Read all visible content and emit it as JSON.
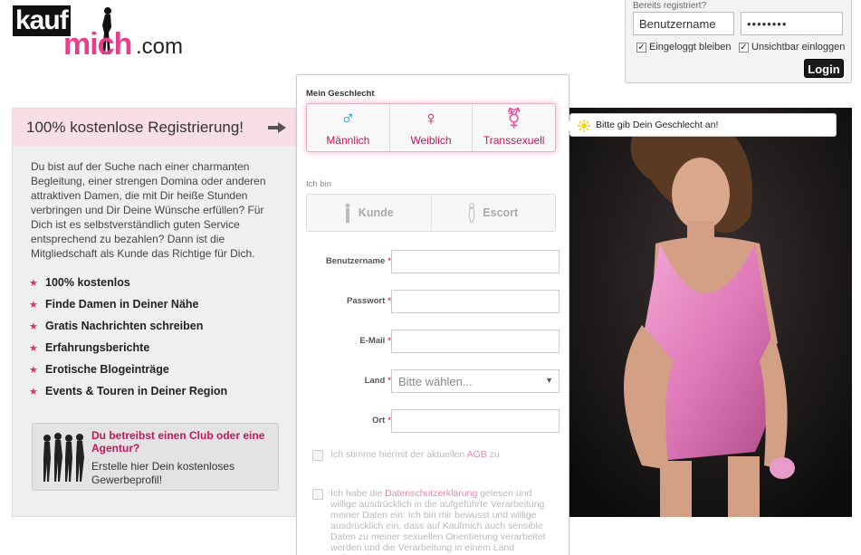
{
  "logo": {
    "part1": "kauf",
    "part2": "mich",
    "part3": ".com"
  },
  "login": {
    "hint": "Bereits registriert?",
    "username_value": "Benutzername",
    "password_value": "••••••••",
    "stay_logged_in": "Eingeloggt bleiben",
    "invisible_login": "Unsichtbar einloggen",
    "login_button": "Login"
  },
  "left": {
    "title": "100% kostenlose Registrierung!",
    "intro": "Du bist auf der Suche nach einer charmanten Begleitung, einer strengen Domina oder anderen attraktiven Damen, die mit Dir heiße Stunden verbringen und Dir Deine Wünsche erfüllen? Für Dich ist es selbstverständlich guten Service entsprechend zu bezahlen? Dann ist die Mitgliedschaft als Kunde das Richtige für Dich.",
    "features": [
      "100% kostenlos",
      "Finde Damen in Deiner Nähe",
      "Gratis Nachrichten schreiben",
      "Erfahrungsberichte",
      "Erotische Blogeinträge",
      "Events & Touren in Deiner Region"
    ],
    "club_title": "Du betreibst einen Club oder eine Agentur?",
    "club_text": "Erstelle hier Dein kostenloses Gewerbeprofil!"
  },
  "form": {
    "gender_label": "Mein Geschlecht",
    "genders": [
      {
        "symbol": "♂",
        "label": "Männlich"
      },
      {
        "symbol": "♀",
        "label": "Weiblich"
      },
      {
        "symbol": "⚧",
        "label": "Transsexuell"
      }
    ],
    "role_label": "Ich bin",
    "roles": [
      "Kunde",
      "Escort"
    ],
    "fields": {
      "username": "Benutzername",
      "password": "Passwort",
      "email": "E-Mail",
      "country": "Land",
      "city": "Ort"
    },
    "required_mark": "*",
    "country_placeholder": "Bitte wählen...",
    "agb_pre": "Ich stimme hiermit der aktuellen ",
    "agb_link": "AGB",
    "agb_post": " zu",
    "privacy_pre": "Ich habe die ",
    "privacy_link": "Datenschutzerklärung",
    "privacy_post": " gelesen und willige ausdrücklich in die aufgeführte Verarbeitung meiner Daten ein: Ich bin mir bewusst und willige ausdrücklich ein, dass auf Kaufmich auch sensible Daten zu meiner sexuellen Orientierung verarbeitet werden und die Verarbeitung in einem Land außerhalb des"
  },
  "tooltip": {
    "text": "Bitte gib Dein Geschlecht an!"
  },
  "colors": {
    "accent": "#e83e8c",
    "accent_dark": "#c2185b",
    "male": "#1e9bd7",
    "header_bg": "#f8dfe6"
  }
}
